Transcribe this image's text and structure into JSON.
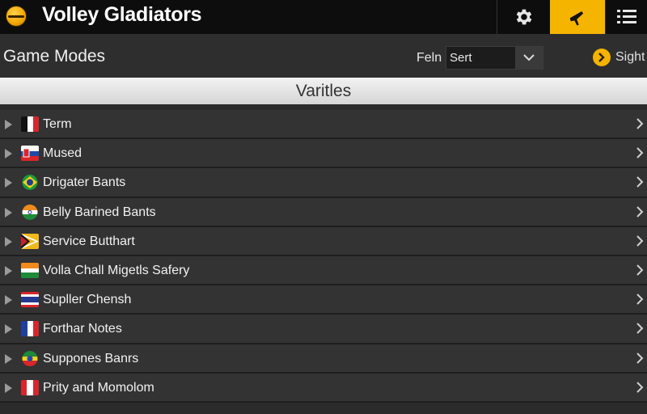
{
  "app": {
    "title": "Volley Gladiators",
    "logo_icon": "volleyball-icon",
    "accent": "#f5b400"
  },
  "toolbar": {
    "buttons": [
      {
        "icon": "gear-icon"
      },
      {
        "icon": "megaphone-icon",
        "active": true
      },
      {
        "icon": "hamburger-menu-icon"
      }
    ]
  },
  "subheader": {
    "title": "Game Modes",
    "filter_label": "Feln",
    "sort_value": "Sert",
    "sight_label": "Sight"
  },
  "section": {
    "title": "Varitles"
  },
  "modes": [
    {
      "label": "Term",
      "flag": "belgium-flag-icon"
    },
    {
      "label": "Mused",
      "flag": "slovakia-flag-icon"
    },
    {
      "label": "Drigater Bants",
      "flag": "brazil-flag-icon"
    },
    {
      "label": "Belly Barined Bants",
      "flag": "india-flag-icon"
    },
    {
      "label": "Service Butthart",
      "flag": "guyana-flag-icon"
    },
    {
      "label": "Volla Chall Migetls Safery",
      "flag": "ireland-flag-icon"
    },
    {
      "label": "Supller Chensh",
      "flag": "thailand-flag-icon"
    },
    {
      "label": "Forthar Notes",
      "flag": "france-flag-icon"
    },
    {
      "label": "Suppones Banrs",
      "flag": "ethiopia-flag-icon"
    },
    {
      "label": "Prity and Momolom",
      "flag": "peru-flag-icon"
    }
  ]
}
